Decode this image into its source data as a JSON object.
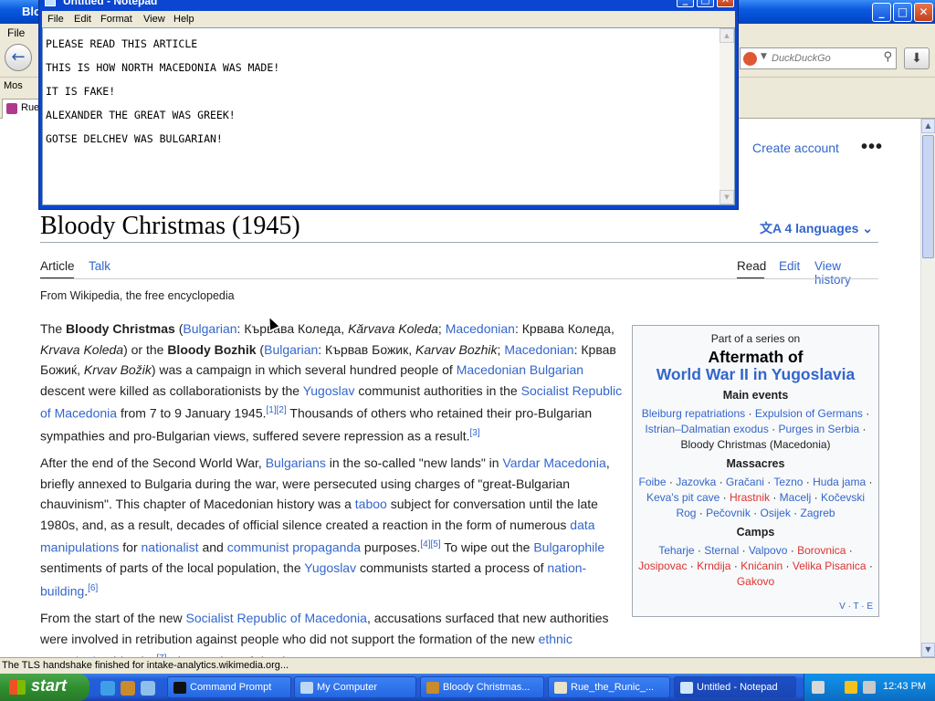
{
  "firefox": {
    "title": "Blo",
    "menu_file": "File",
    "search_placeholder": "DuckDuckGo",
    "bookmark": "Mos",
    "tab_label": "Rue",
    "status": "The TLS handshake finished for intake-analytics.wikimedia.org..."
  },
  "wiki": {
    "create_account": "Create account",
    "title": "Bloody Christmas (1945)",
    "languages": "4 languages",
    "tab_article": "Article",
    "tab_talk": "Talk",
    "tab_read": "Read",
    "tab_edit": "Edit",
    "tab_history": "View history",
    "from_wiki": "From Wikipedia, the free encyclopedia",
    "infobox": {
      "pre": "Part of a series on",
      "title1": "Aftermath of",
      "title2": "World War II in Yugoslavia",
      "sec_main": "Main events",
      "main_events": "Bleiburg repatriations · Expulsion of Germans · Istrian–Dalmatian exodus · Purges in Serbia · Bloody Christmas (Macedonia)",
      "sec_massacres": "Massacres",
      "massacres": "Foibe · Jazovka · Gračani · Tezno · Huda jama · Keva's pit cave · Hrastnik · Macelj · Kočevski Rog · Pečovnik · Osijek · Zagreb",
      "sec_camps": "Camps",
      "camps": "Teharje · Sterntal · Valpovo · Borovnica · Josipovac · Krndija · Knićanin · Velika Pisanica · Gakovo",
      "vte": "V · T · E"
    }
  },
  "notepad": {
    "title": "Untitled - Notepad",
    "menu": [
      "File",
      "Edit",
      "Format",
      "View",
      "Help"
    ],
    "text": "PLEASE READ THIS ARTICLE\nTHIS IS HOW NORTH MACEDONIA WAS MADE!\nIT IS FAKE!\nALEXANDER THE GREAT WAS GREEK!\nGOTSE DELCHEV WAS BULGARIAN!"
  },
  "taskbar": {
    "start": "start",
    "tasks": [
      "Command Prompt",
      "My Computer",
      "Bloody Christmas...",
      "Rue_the_Runic_...",
      "Untitled - Notepad"
    ],
    "clock": "12:43 PM"
  }
}
